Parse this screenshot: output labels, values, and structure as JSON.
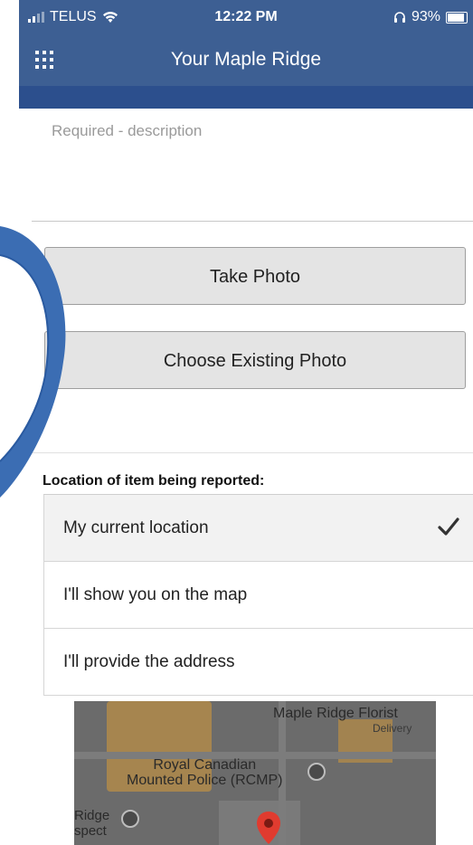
{
  "status_bar": {
    "carrier": "TELUS",
    "time": "12:22 PM",
    "battery": "93%"
  },
  "nav": {
    "title": "Your Maple Ridge",
    "menu_icon": "grid-menu-icon"
  },
  "form": {
    "description_placeholder": "Required - description",
    "take_photo_label": "Take Photo",
    "choose_photo_label": "Choose Existing Photo"
  },
  "location": {
    "heading": "Location of item being reported:",
    "options": [
      {
        "label": "My current location",
        "selected": true
      },
      {
        "label": "I'll show you on the map",
        "selected": false
      },
      {
        "label": "I'll provide the address",
        "selected": false
      }
    ]
  },
  "map": {
    "labels": {
      "florist": "Maple Ridge Florist",
      "florist_sub": "Delivery",
      "rcmp": "Royal Canadian\nMounted Police (RCMP)",
      "ridge": "Ridge\nspect"
    }
  },
  "colors": {
    "header_blue": "#3d5f93",
    "strip_blue": "#2c4f8d",
    "arc_blue": "#3b6db3"
  }
}
